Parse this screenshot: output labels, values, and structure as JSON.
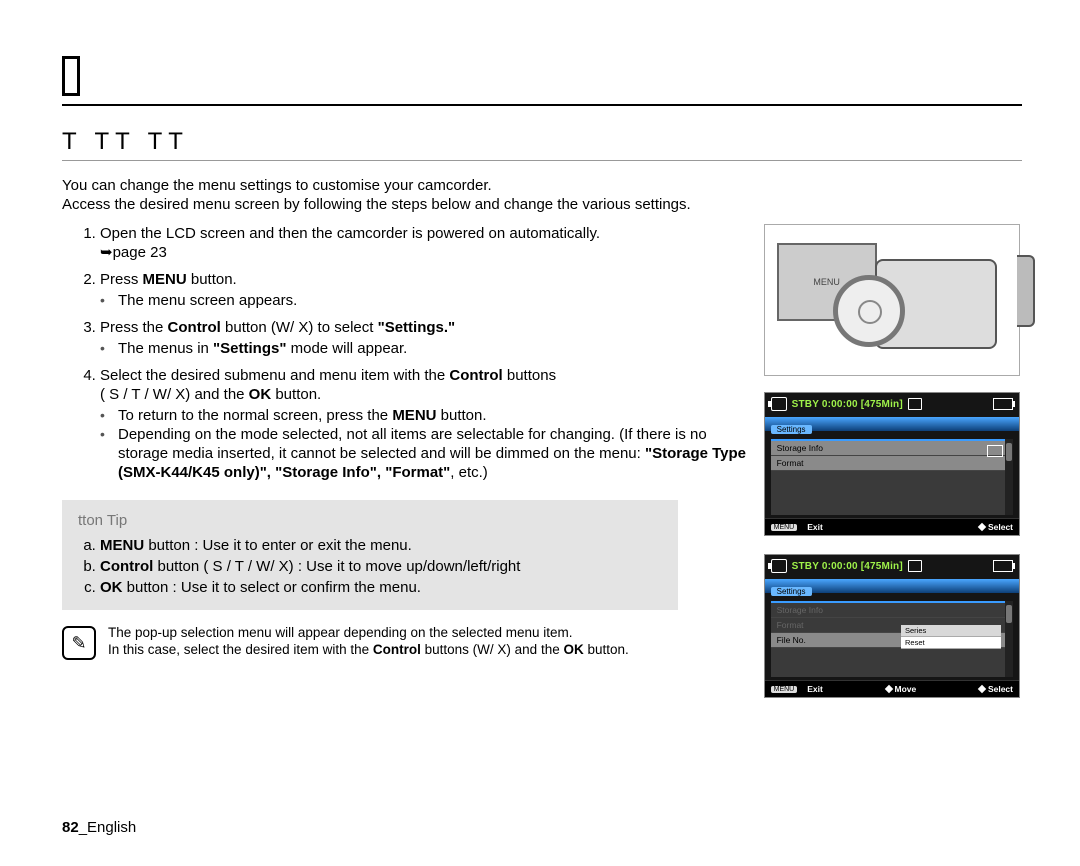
{
  "section_title": "T TT TT",
  "intro_line1": "You can change the menu settings to customise your camcorder.",
  "intro_line2": "Access the desired menu screen by following the steps below and change the various settings.",
  "steps": {
    "s1a": "Open the LCD screen and then the camcorder is powered on automatically.",
    "s1b": "➥page 23",
    "s2a": "Press ",
    "s2b": "MENU",
    "s2c": " button.",
    "s2sub": "The menu screen appears.",
    "s3a": "Press the ",
    "s3b": "Control",
    "s3c": " button (W/  X) to select ",
    "s3d": "\"Settings.\"",
    "s3sub_a": "The menus in ",
    "s3sub_b": "\"Settings\"",
    "s3sub_c": " mode will appear.",
    "s4a": "Select the desired submenu and menu item with the ",
    "s4b": "Control",
    "s4c": " buttons",
    "s4d": "( S /  T /  W/  X) and the ",
    "s4e": "OK",
    "s4f": " button.",
    "s4sub1_a": "To return to the normal screen, press the ",
    "s4sub1_b": "MENU",
    "s4sub1_c": " button.",
    "s4sub2": "Depending on the mode selected, not all items are selectable for changing. (If there is no storage media inserted, it cannot be selected and will be dimmed on the menu: ",
    "s4sub2b": "\"Storage Type (SMX-K44/K45 only)\", \"Storage Info\", \"Format\"",
    "s4sub2c": ", etc.)"
  },
  "tip": {
    "title": "tton Tip",
    "a1": "MENU",
    "a2": " button : Use it to enter or exit the menu.",
    "b1": "Control",
    "b2": " button ( S /  T /  W/  X) : Use it to move up/down/left/right",
    "c1": "OK",
    "c2": " button : Use it to select or confirm the menu."
  },
  "note": {
    "line1": "The pop-up selection menu will appear depending on the selected menu item.",
    "line2a": "In this case, select the desired item with the ",
    "line2b": "Control",
    "line2c": " buttons (W/  X) and the ",
    "line2d": "OK",
    "line2e": " button."
  },
  "rhs": {
    "lcd_label": "MENU",
    "status": "STBY 0:00:00 [475Min]",
    "tab_active": "Settings",
    "menu_items": [
      "Storage Info",
      "Format",
      "File No."
    ],
    "popup_items": [
      "Series",
      "Reset"
    ],
    "popup_selected_index": 1,
    "bottom": {
      "menu": "MENU",
      "exit": "Exit",
      "move": "Move",
      "select": "Select"
    }
  },
  "page_number": "82",
  "page_lang": "English"
}
